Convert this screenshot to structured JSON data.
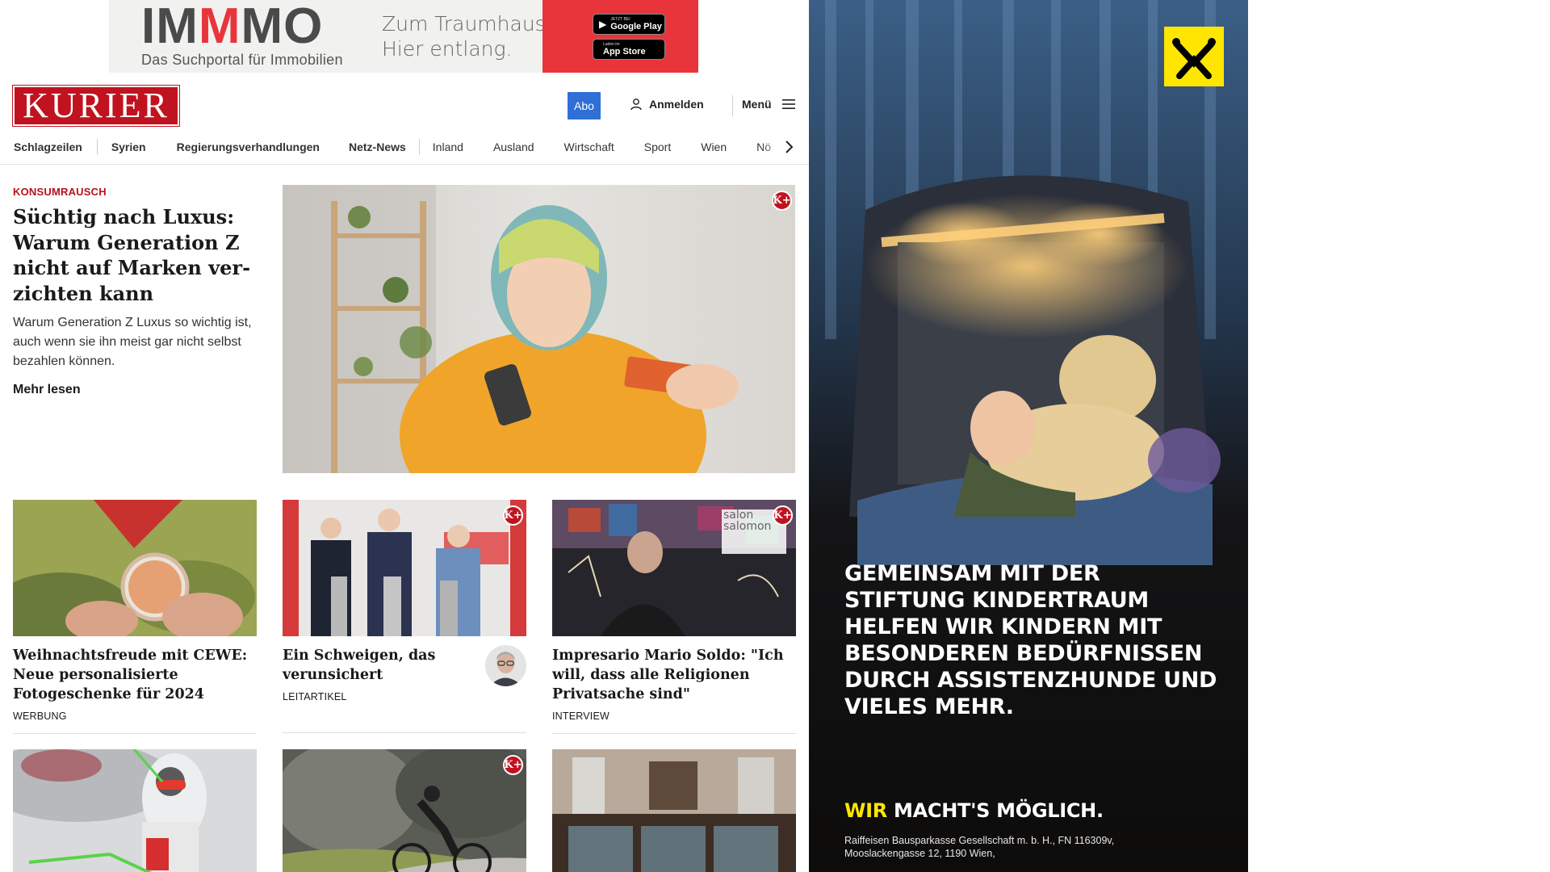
{
  "top_ad": {
    "brand_prefix": "IM",
    "brand_red": "M",
    "brand_suffix": "MO",
    "brand_sub": "Das Suchportal für Immobilien",
    "claim_line1": "Zum Traumhaus?",
    "claim_line2": "Hier entlang.",
    "google_play_small": "JETZT BEI",
    "google_play": "Google Play",
    "app_store_small": "Laden im",
    "app_store": "App Store",
    "accent_color": "#e8353b"
  },
  "header": {
    "logo": "KURIER",
    "logo_color": "#c1121f",
    "abo": "Abo",
    "login": "Anmelden",
    "menu": "Menü",
    "abo_color": "#2f6fd6"
  },
  "nav": {
    "items": [
      "Schlagzeilen",
      "Syrien",
      "Regierungsverhandlungen",
      "Netz-News",
      "Inland",
      "Ausland",
      "Wirtschaft",
      "Sport",
      "Wien",
      "Nö"
    ]
  },
  "hero": {
    "kicker": "KONSUMRAUSCH",
    "title": "Süchtig nach Luxus: Warum Generation Z nicht auf Marken ver­zichten kann",
    "lead": "Warum Generation Z Luxus so wichtig ist, auch wenn sie ihn meist gar nicht selbst bezahlen können.",
    "more": "Mehr lesen",
    "premium": true
  },
  "cards": [
    {
      "title": "Weihnachtsfreude mit CEWE: Neue personalisierte Fotogeschenke für 2024",
      "label": "WERBUNG",
      "premium": false
    },
    {
      "title": "Ein Schweigen, das verunsichert",
      "label": "LEITARTIKEL",
      "premium": true
    },
    {
      "title": "Impresario Mario Soldo: \"Ich will, dass alle Religionen Privatsache sind\"",
      "label": "INTERVIEW",
      "premium": true,
      "overlay_text": "salon salomon"
    },
    {
      "premium": false
    },
    {
      "premium": true
    },
    {
      "premium": false
    }
  ],
  "premium_badge": "K+",
  "side_ad": {
    "copy": "Gemeinsam mit der Stiftung Kindertraum helfen wir Kindern mit besonderen Bedürfnissen durch Assistenzhunde und vieles mehr.",
    "slogan_wir": "WIR",
    "slogan_rest": "MACHT'S MÖGLICH.",
    "legal": "Raiffeisen Bausparkasse Gesellschaft m. b. H., FN 116309v, Mooslackengasse 12, 1190 Wien,",
    "brand_color": "#ffe600"
  }
}
